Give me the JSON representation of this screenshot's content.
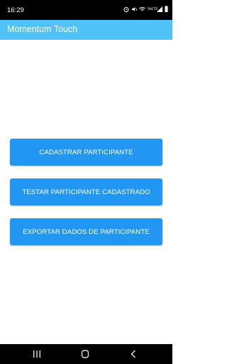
{
  "status_bar": {
    "time": "16:29",
    "icons": [
      "alarm-icon",
      "mute-icon",
      "wifi-icon",
      "lte-icon",
      "signal-icon",
      "battery-icon"
    ],
    "lte_label": "VoLTE"
  },
  "app_bar": {
    "title": "Momentum Touch",
    "color": "#4fc3f7"
  },
  "buttons": {
    "register": "CADASTRAR PARTICIPANTE",
    "test": "TESTAR PARTICIPANTE CADASTRADO",
    "export": "EXPORTAR DADOS DE PARTICIPANTE",
    "color": "#2196f3"
  },
  "nav_bar": {
    "items": [
      "recents-icon",
      "home-icon",
      "back-icon"
    ]
  }
}
